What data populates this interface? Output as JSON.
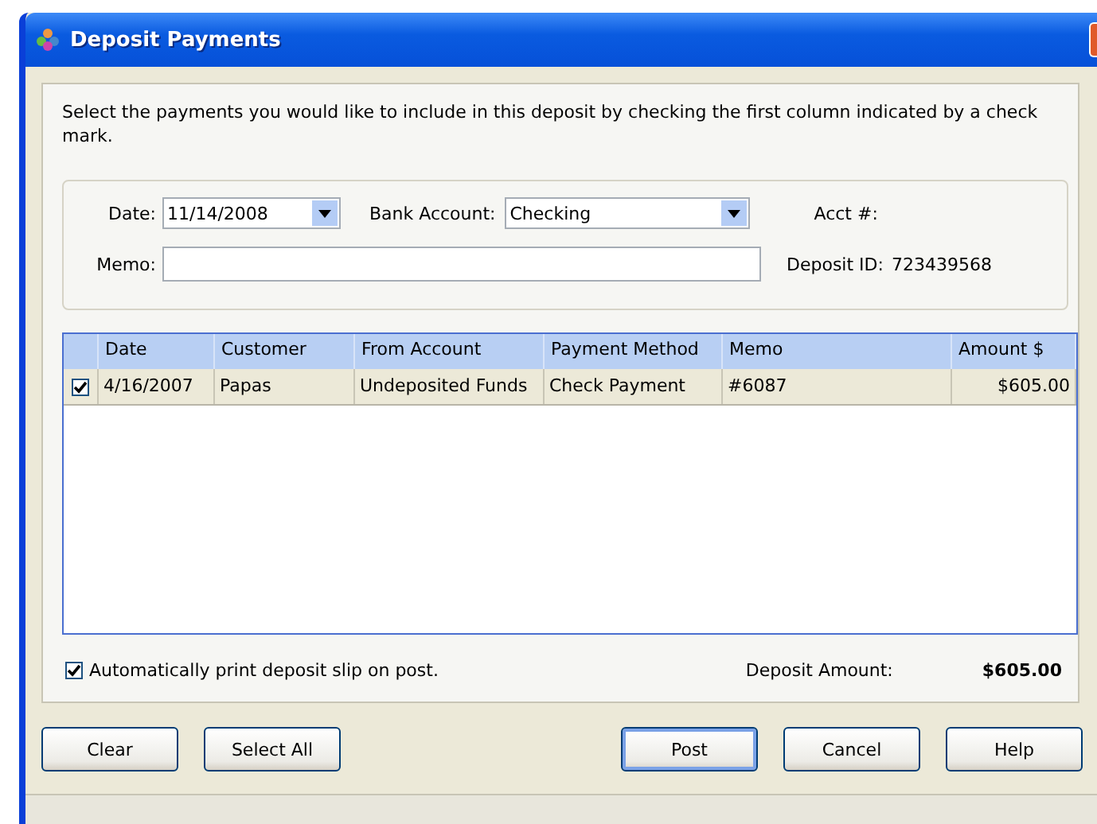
{
  "window": {
    "title": "Deposit Payments"
  },
  "instructions": "Select the payments you would like to include in this deposit by checking the first column indicated by a check mark.",
  "form": {
    "date_label": "Date:",
    "date": "11/14/2008",
    "bank_account_label": "Bank Account:",
    "bank_account": "Checking",
    "acct_label": "Acct #:",
    "memo_label": "Memo:",
    "deposit_id_label": "Deposit ID:",
    "deposit_id": "723439568"
  },
  "table": {
    "columns": [
      "Date",
      "Customer",
      "From Account",
      "Payment Method",
      "Memo",
      "Amount $"
    ],
    "rows": [
      {
        "checked": true,
        "cells": [
          "4/16/2007",
          "Papas",
          "Undeposited Funds",
          "Check Payment",
          "#6087",
          "$605.00"
        ]
      }
    ]
  },
  "auto_print": {
    "label": "Automatically print deposit slip on post.",
    "checked": true
  },
  "deposit_amount": {
    "label": "Deposit Amount:",
    "value": "$605.00"
  },
  "buttons_left": [
    {
      "label": "Clear",
      "default": false
    },
    {
      "label": "Select All",
      "default": false
    }
  ],
  "buttons_right": [
    {
      "label": "Post",
      "default": true
    },
    {
      "label": "Cancel",
      "default": false
    },
    {
      "label": "Help",
      "default": false
    }
  ]
}
